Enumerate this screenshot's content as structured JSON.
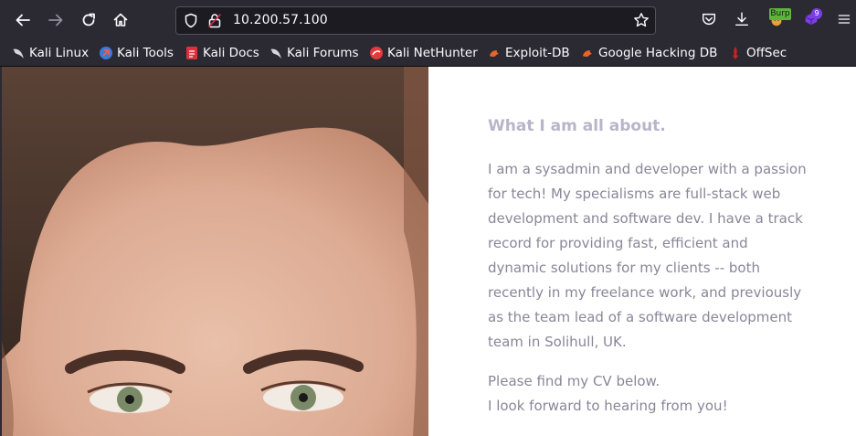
{
  "browser": {
    "url": "10.200.57.100",
    "burp_badge": "Burp",
    "extension_badge": "9"
  },
  "bookmarks": [
    {
      "label": "Kali Linux",
      "icon": "kali-dragon-icon"
    },
    {
      "label": "Kali Tools",
      "icon": "kali-tools-icon"
    },
    {
      "label": "Kali Docs",
      "icon": "kali-docs-icon"
    },
    {
      "label": "Kali Forums",
      "icon": "kali-dragon-icon"
    },
    {
      "label": "Kali NetHunter",
      "icon": "nethunter-icon"
    },
    {
      "label": "Exploit-DB",
      "icon": "exploit-db-icon"
    },
    {
      "label": "Google Hacking DB",
      "icon": "exploit-db-icon"
    },
    {
      "label": "OffSec",
      "icon": "offsec-icon"
    }
  ],
  "page": {
    "heading": "What I am all about.",
    "paragraph": "I am a sysadmin and developer with a passion for tech! My specialisms are full-stack web development and software dev. I have a track record for providing fast, efficient and dynamic solutions for my clients -- both recently in my freelance work, and previously as the team lead of a software development team in Solihull, UK.",
    "cv_line1": "Please find my CV below.",
    "cv_line2": "I look forward to hearing from you!"
  },
  "colors": {
    "chrome_bg": "#2b2a33",
    "urlbar_bg": "#1c1b22",
    "heading": "#b8b5c9",
    "body_text": "#8a8698"
  }
}
